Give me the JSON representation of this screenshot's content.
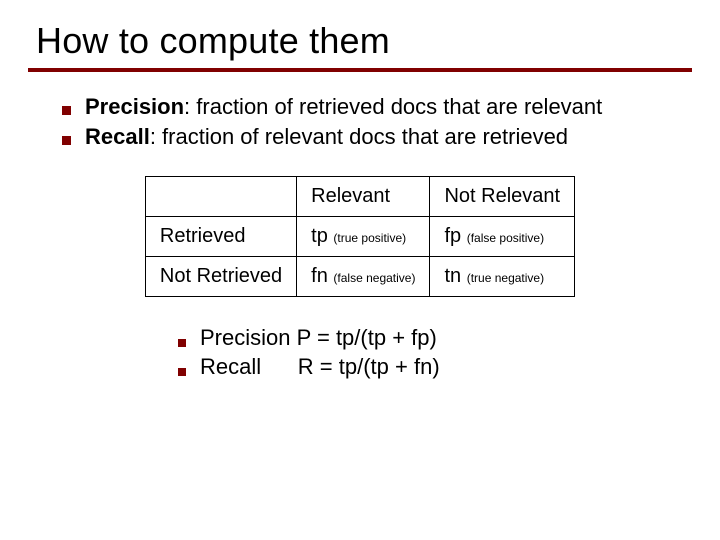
{
  "title": "How to compute them",
  "defs": {
    "precision": {
      "term": "Precision",
      "text": ": fraction of retrieved docs that are relevant"
    },
    "recall": {
      "term": "Recall",
      "text": ": fraction of relevant docs that are retrieved"
    }
  },
  "table": {
    "col1": "Relevant",
    "col2": "Not Relevant",
    "row1_label": "Retrieved",
    "row2_label": "Not Retrieved",
    "tp": {
      "sym": "tp",
      "note": "(true positive)"
    },
    "fp": {
      "sym": "fp",
      "note": "(false positive)"
    },
    "fn": {
      "sym": "fn",
      "note": "(false negative)"
    },
    "tn": {
      "sym": "tn",
      "note": "(true negative)"
    }
  },
  "formulas": {
    "precision": "Precision P = tp/(tp + fp)",
    "recall": "Recall      R = tp/(tp + fn)"
  }
}
